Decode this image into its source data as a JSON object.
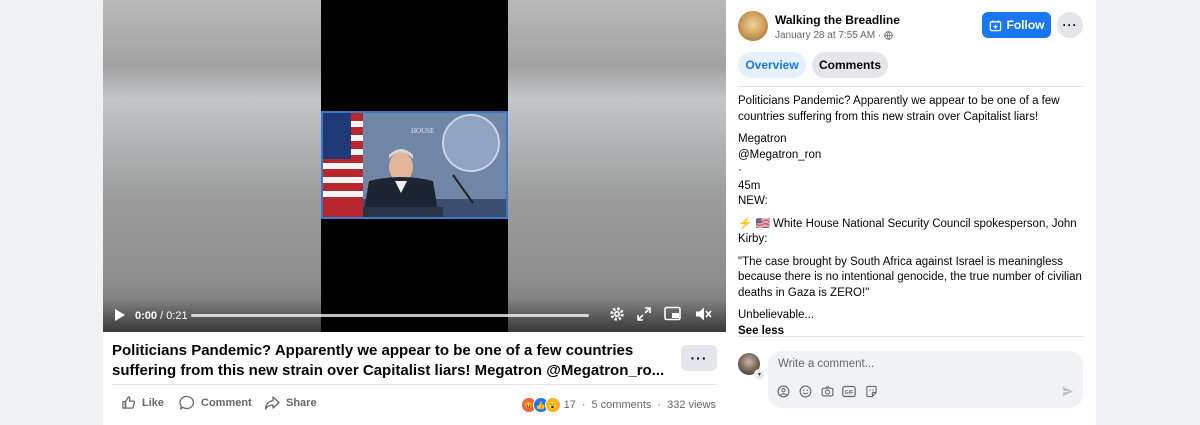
{
  "video": {
    "time_current": "0:00",
    "time_total": "/ 0:21"
  },
  "post": {
    "title": "Politicians Pandemic? Apparently we appear to be one of a few countries suffering from this new strain over Capitalist liars! Megatron @Megatron_ro...",
    "more_label": "···",
    "actions": {
      "like": "Like",
      "comment": "Comment",
      "share": "Share"
    },
    "stats": {
      "reactions_count": "17",
      "comments": "5 comments",
      "views": "332 views"
    }
  },
  "sidebar": {
    "page_name": "Walking the Breadline",
    "post_time": "January 28 at 7:55 AM ·",
    "follow_label": "Follow",
    "more_label": "···",
    "tabs": [
      {
        "label": "Overview",
        "active": true
      },
      {
        "label": "Comments",
        "active": false
      }
    ],
    "body": {
      "intro": "Politicians Pandemic? Apparently we appear to be one of a few countries suffering from this new strain over Capitalist liars!",
      "author_name": "Megatron",
      "author_handle": "@Megatron_ron",
      "dot": "·",
      "age": "45m",
      "new_label": "NEW:",
      "headline_prefix": "⚡ 🇺🇸",
      "headline": "White House National Security Council spokesperson, John Kirby:",
      "quote": "\"The case brought by South Africa against Israel is meaningless because there is no intentional genocide, the true number of civilian deaths in Gaza is ZERO!\"",
      "closing": "Unbelievable...",
      "see_less": "See less"
    },
    "comment_placeholder": "Write a comment..."
  },
  "colors": {
    "accent": "#1877f2",
    "background": "#f0f2f5",
    "text_secondary": "#65676b"
  }
}
